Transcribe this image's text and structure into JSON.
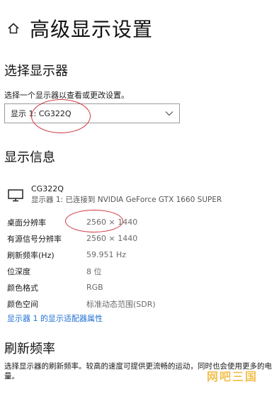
{
  "header": {
    "home_icon": "home-icon",
    "title": "高级显示设置"
  },
  "select_display": {
    "title": "选择显示器",
    "description": "选择一个显示器以查看或更改设置。",
    "dropdown_value": "显示 1: CG322Q"
  },
  "display_info": {
    "title": "显示信息",
    "monitor_icon": "monitor-icon",
    "monitor_name": "CG322Q",
    "monitor_subtitle": "显示器 1: 已连接到 NVIDIA GeForce GTX 1660 SUPER",
    "rows": [
      {
        "label": "桌面分辨率",
        "value": "2560 × 1440"
      },
      {
        "label": "有源信号分辨率",
        "value": "2560 × 1440"
      },
      {
        "label": "刷新频率(Hz)",
        "value": "59.951 Hz"
      },
      {
        "label": "位深度",
        "value": "8 位"
      },
      {
        "label": "颜色格式",
        "value": "RGB"
      },
      {
        "label": "颜色空间",
        "value": "标准动态范围(SDR)"
      }
    ],
    "adapter_link": "显示器 1 的显示适配器属性"
  },
  "refresh_rate": {
    "title": "刷新频率",
    "description": "选择显示器的刷新频率。较高的速度可提供更流畅的运动，同时也会使用更多的电量。"
  },
  "watermark": "网吧三国",
  "colors": {
    "annotation": "#d0353d",
    "link": "#1f6fd1",
    "watermark": "#f2b632"
  }
}
